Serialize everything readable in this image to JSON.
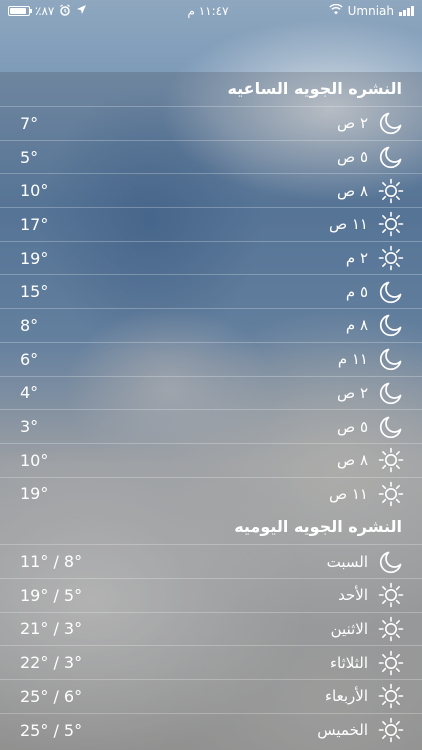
{
  "status_bar": {
    "battery_percent": "٪٨٧",
    "battery_level": 0.87,
    "time": "١١:٤٧ م",
    "carrier": "Umniah",
    "alarm_icon": "alarm-clock-icon",
    "location_icon": "location-arrow-icon",
    "wifi_icon": "wifi-icon",
    "signal_icon": "signal-bars-icon"
  },
  "hourly": {
    "title": "النشره الجويه الساعيه",
    "rows": [
      {
        "time": "٢ ص",
        "temp": "7°",
        "icon": "moon"
      },
      {
        "time": "٥ ص",
        "temp": "5°",
        "icon": "moon"
      },
      {
        "time": "٨ ص",
        "temp": "10°",
        "icon": "sun"
      },
      {
        "time": "١١ ص",
        "temp": "17°",
        "icon": "sun"
      },
      {
        "time": "٢ م",
        "temp": "19°",
        "icon": "sun"
      },
      {
        "time": "٥ م",
        "temp": "15°",
        "icon": "moon"
      },
      {
        "time": "٨ م",
        "temp": "8°",
        "icon": "moon"
      },
      {
        "time": "١١ م",
        "temp": "6°",
        "icon": "moon"
      },
      {
        "time": "٢ ص",
        "temp": "4°",
        "icon": "moon"
      },
      {
        "time": "٥ ص",
        "temp": "3°",
        "icon": "moon"
      },
      {
        "time": "٨ ص",
        "temp": "10°",
        "icon": "sun"
      },
      {
        "time": "١١ ص",
        "temp": "19°",
        "icon": "sun"
      }
    ]
  },
  "daily": {
    "title": "النشره الجويه اليوميه",
    "rows": [
      {
        "day": "السبت",
        "temp": "11° / 8°",
        "icon": "moon"
      },
      {
        "day": "الأحد",
        "temp": "19° / 5°",
        "icon": "sun"
      },
      {
        "day": "الاثنين",
        "temp": "21° / 3°",
        "icon": "sun"
      },
      {
        "day": "الثلاثاء",
        "temp": "22° / 3°",
        "icon": "sun"
      },
      {
        "day": "الأربعاء",
        "temp": "25° / 6°",
        "icon": "sun"
      },
      {
        "day": "الخميس",
        "temp": "25° / 5°",
        "icon": "sun"
      }
    ]
  }
}
